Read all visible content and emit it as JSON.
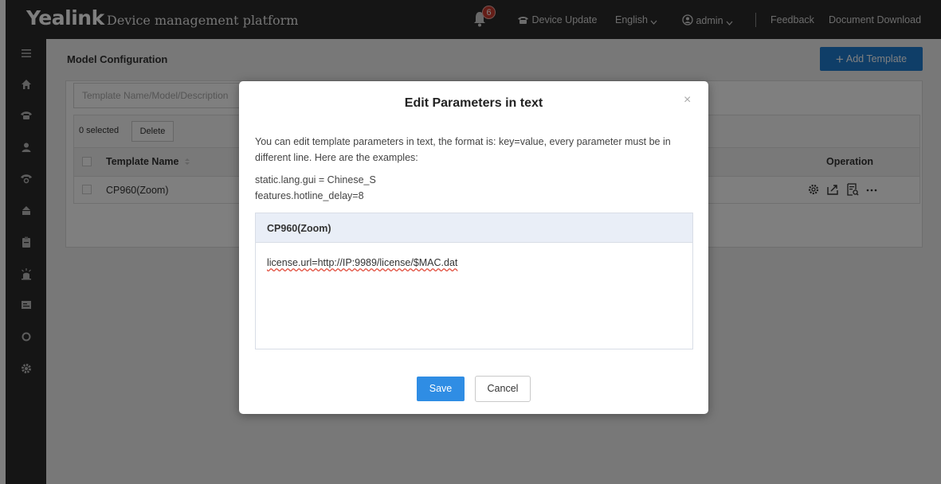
{
  "header": {
    "logo": "Yealink",
    "title": "Device management platform",
    "notification_count": "6",
    "device_update": "Device Update",
    "language": "English",
    "user": "admin",
    "feedback": "Feedback",
    "document_download": "Document Download"
  },
  "page": {
    "title": "Model Configuration",
    "add_template": "Add Template",
    "search_placeholder": "Template Name/Model/Description",
    "selected": "0 selected",
    "delete": "Delete",
    "columns": {
      "template_name": "Template Name",
      "operation": "Operation"
    },
    "rows": [
      {
        "template_name": "CP960(Zoom)"
      }
    ]
  },
  "modal": {
    "title": "Edit Parameters in text",
    "close": "×",
    "description": "You can edit template parameters in text, the format is: key=value, every parameter must be in different line. Here are the examples:",
    "examples": [
      "static.lang.gui = Chinese_S",
      "features.hotline_delay=8"
    ],
    "editor_title": "CP960(Zoom)",
    "editor_content": "license.url=http://IP:9989/license/$MAC.dat",
    "save": "Save",
    "cancel": "Cancel"
  },
  "colors": {
    "topbar": "#2b2b2b",
    "sidebar": "#2a2a2a",
    "primary_button": "#1f7cd0",
    "save_button": "#2f8de4",
    "badge": "#c83a2e"
  }
}
